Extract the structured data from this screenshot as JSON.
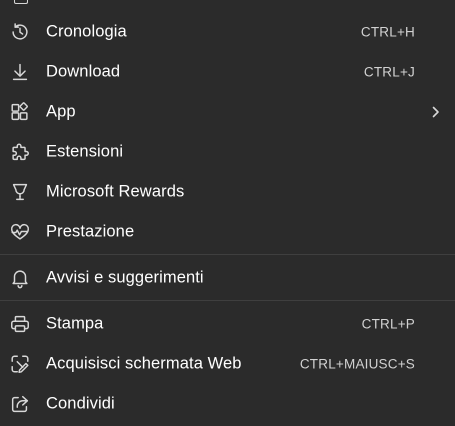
{
  "menu": {
    "items": [
      {
        "label": "Cronologia",
        "shortcut": "CTRL+H",
        "icon": "history-icon"
      },
      {
        "label": "Download",
        "shortcut": "CTRL+J",
        "icon": "download-icon"
      },
      {
        "label": "App",
        "shortcut": "",
        "icon": "apps-icon",
        "has_submenu": true
      },
      {
        "label": "Estensioni",
        "shortcut": "",
        "icon": "extensions-icon"
      },
      {
        "label": "Microsoft Rewards",
        "shortcut": "",
        "icon": "rewards-icon"
      },
      {
        "label": "Prestazione",
        "shortcut": "",
        "icon": "performance-icon"
      },
      {
        "label": "Avvisi e suggerimenti",
        "shortcut": "",
        "icon": "bell-icon"
      },
      {
        "label": "Stampa",
        "shortcut": "CTRL+P",
        "icon": "print-icon"
      },
      {
        "label": "Acquisisci schermata Web",
        "shortcut": "CTRL+MAIUSC+S",
        "icon": "web-capture-icon"
      },
      {
        "label": "Condividi",
        "shortcut": "",
        "icon": "share-icon"
      }
    ]
  },
  "colors": {
    "background": "#2b2b2b",
    "text": "#ffffff",
    "shortcut_text": "#d2d2d2",
    "icon_stroke": "#d8d8d8",
    "divider": "#3f3f3f"
  }
}
